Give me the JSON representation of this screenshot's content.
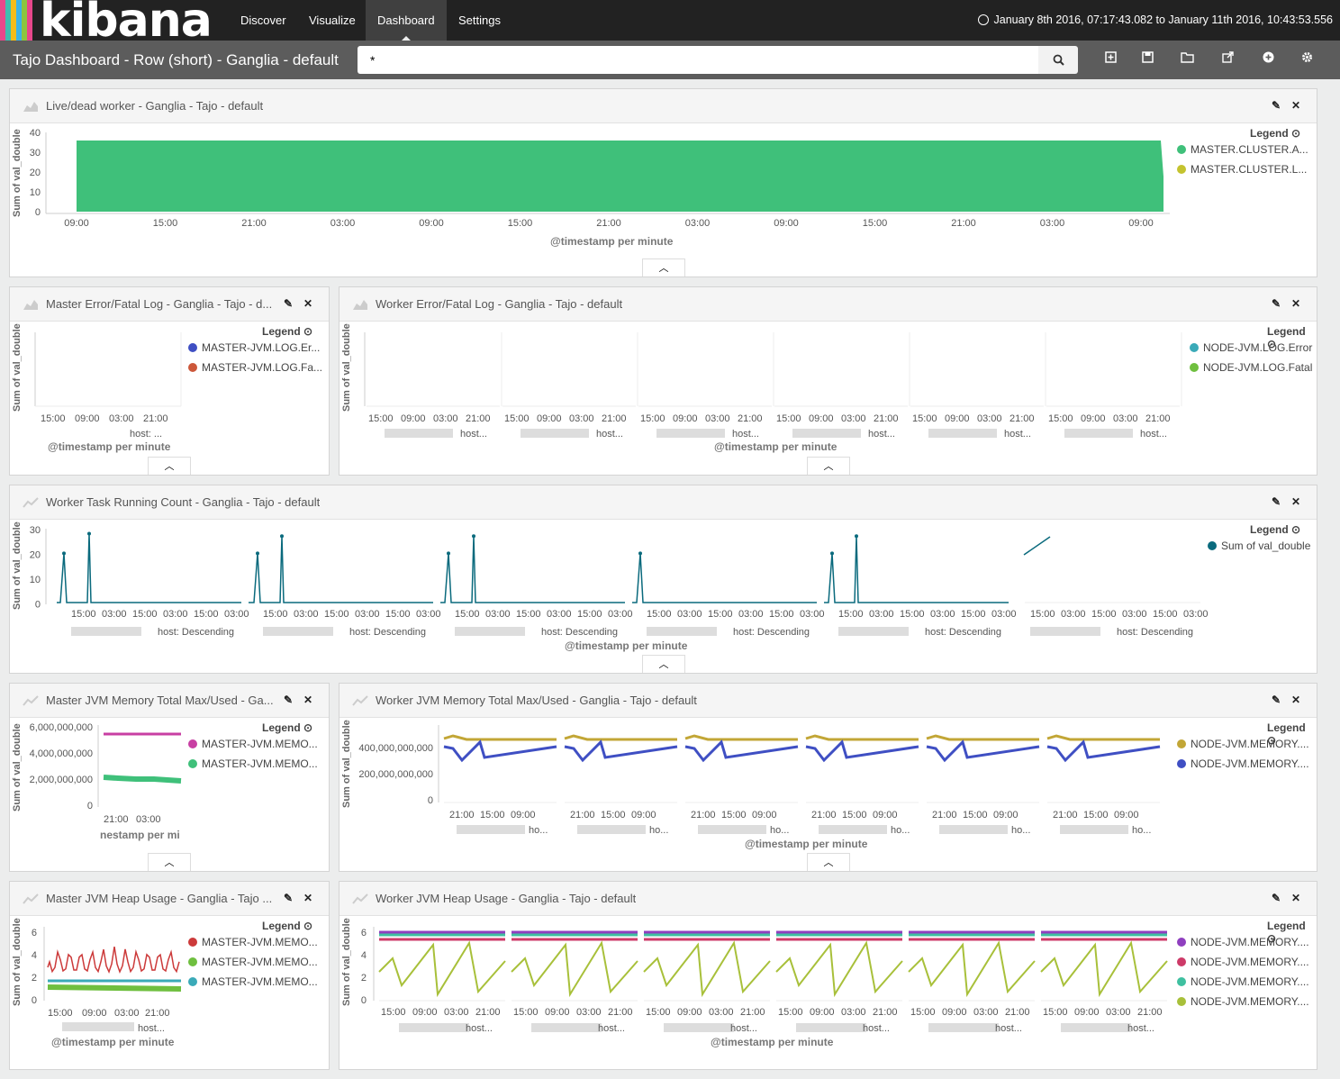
{
  "nav": {
    "logo": "kibana",
    "tabs": [
      "Discover",
      "Visualize",
      "Dashboard",
      "Settings"
    ],
    "active_tab": "Dashboard",
    "time_range": "January 8th 2016, 07:17:43.082 to January 11th 2016, 10:43:53.556"
  },
  "dashboard": {
    "title": "Tajo Dashboard - Row (short) - Ganglia - default",
    "query": "*"
  },
  "colors": {
    "green": "#3fc07a",
    "olive": "#c4c32f",
    "blue": "#3f4fc3",
    "red": "#cc573a",
    "teal": "#3aaab8",
    "lime": "#6fbf3f",
    "dark_teal": "#0a6a7d",
    "mustard": "#c2a636",
    "magenta": "#c83fa3",
    "purple": "#8f3fbf",
    "lime2": "#a8c03a",
    "crimson": "#cd3a68"
  },
  "panels": {
    "live": {
      "title": "Live/dead worker - Ganglia - Tajo - default",
      "legend_title": "Legend",
      "legend": [
        "MASTER.CLUSTER.A...",
        "MASTER.CLUSTER.L..."
      ],
      "ylabel": "Sum of val_double",
      "xlabel": "@timestamp per minute",
      "yticks": [
        "40",
        "30",
        "20",
        "10",
        "0"
      ],
      "xticks": [
        "09:00",
        "15:00",
        "21:00",
        "03:00",
        "09:00",
        "15:00",
        "21:00",
        "03:00",
        "09:00",
        "15:00",
        "21:00",
        "03:00",
        "09:00"
      ]
    },
    "master_err": {
      "title": "Master Error/Fatal Log - Ganglia - Tajo - d...",
      "legend_title": "Legend",
      "legend": [
        "MASTER-JVM.LOG.Er...",
        "MASTER-JVM.LOG.Fa..."
      ],
      "ylabel": "Sum of val_double",
      "xlabel": "@timestamp per minute",
      "xticks": [
        "15:00",
        "09:00",
        "03:00",
        "21:00"
      ],
      "host_label": "host: ..."
    },
    "worker_err": {
      "title": "Worker Error/Fatal Log - Ganglia - Tajo - default",
      "legend_title": "Legend",
      "legend": [
        "NODE-JVM.LOG.Error",
        "NODE-JVM.LOG.Fatal"
      ],
      "ylabel": "Sum of val_double",
      "xlabel": "@timestamp per minute",
      "xticks": [
        "15:00",
        "09:00",
        "03:00",
        "21:00"
      ],
      "host_label": "host..."
    },
    "task": {
      "title": "Worker Task Running Count - Ganglia - Tajo - default",
      "legend_title": "Legend",
      "legend": [
        "Sum of val_double"
      ],
      "ylabel": "Sum of val_double",
      "xlabel": "@timestamp per minute",
      "yticks": [
        "30",
        "20",
        "10",
        "0"
      ],
      "xticks": [
        "15:00",
        "03:00",
        "15:00",
        "03:00",
        "15:00",
        "03:00"
      ],
      "host_label": "host: Descending"
    },
    "master_mem": {
      "title": "Master JVM Memory Total Max/Used - Ga...",
      "legend_title": "Legend",
      "legend": [
        "MASTER-JVM.MEMO...",
        "MASTER-JVM.MEMO..."
      ],
      "ylabel": "Sum of val_double",
      "xlabel": "nestamp per mi",
      "yticks": [
        "6,000,000,000",
        "4,000,000,000",
        "2,000,000,000",
        "0"
      ],
      "xticks": [
        "21:00",
        "03:00"
      ]
    },
    "worker_mem": {
      "title": "Worker JVM Memory Total Max/Used - Ganglia - Tajo - default",
      "legend_title": "Legend",
      "legend": [
        "NODE-JVM.MEMORY....",
        "NODE-JVM.MEMORY...."
      ],
      "ylabel": "Sum of val_double",
      "xlabel": "@timestamp per minute",
      "yticks": [
        "400,000,000,000",
        "200,000,000,000",
        "0"
      ],
      "xticks": [
        "21:00",
        "15:00",
        "09:00"
      ],
      "host_label": "ho..."
    },
    "master_heap": {
      "title": "Master JVM Heap Usage - Ganglia - Tajo ...",
      "legend_title": "Legend",
      "legend": [
        "MASTER-JVM.MEMO...",
        "MASTER-JVM.MEMO...",
        "MASTER-JVM.MEMO..."
      ],
      "ylabel": "Sum of val_double",
      "xlabel": "@timestamp per minute",
      "yticks": [
        "6",
        "4",
        "2",
        "0"
      ],
      "xticks": [
        "15:00",
        "09:00",
        "03:00",
        "21:00"
      ],
      "host_label": "host..."
    },
    "worker_heap": {
      "title": "Worker JVM Heap Usage - Ganglia - Tajo - default",
      "legend_title": "Legend",
      "legend": [
        "NODE-JVM.MEMORY....",
        "NODE-JVM.MEMORY....",
        "NODE-JVM.MEMORY....",
        "NODE-JVM.MEMORY...."
      ],
      "ylabel": "Sum of val_double",
      "xlabel": "@timestamp per minute",
      "yticks": [
        "6",
        "4",
        "2",
        "0"
      ],
      "xticks": [
        "15:00",
        "09:00",
        "03:00",
        "21:00"
      ],
      "host_label": "host..."
    }
  }
}
